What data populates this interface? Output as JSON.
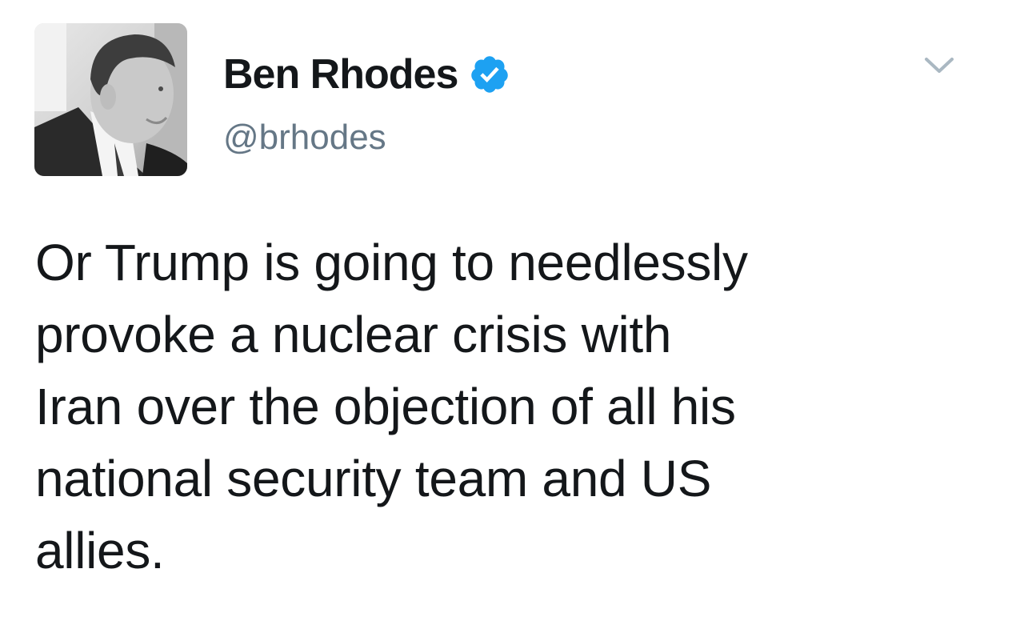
{
  "author": {
    "display_name": "Ben Rhodes",
    "handle": "@brhodes",
    "verified": true,
    "verified_icon": "verified-badge-icon",
    "verified_color": "#1da1f2"
  },
  "menu": {
    "icon": "chevron-down-icon",
    "color": "#aab8c2"
  },
  "tweet": {
    "text": "Or Trump is going to needlessly\nprovoke a nuclear crisis with\nIran over the objection of all his\nnational security team and US\nallies."
  }
}
